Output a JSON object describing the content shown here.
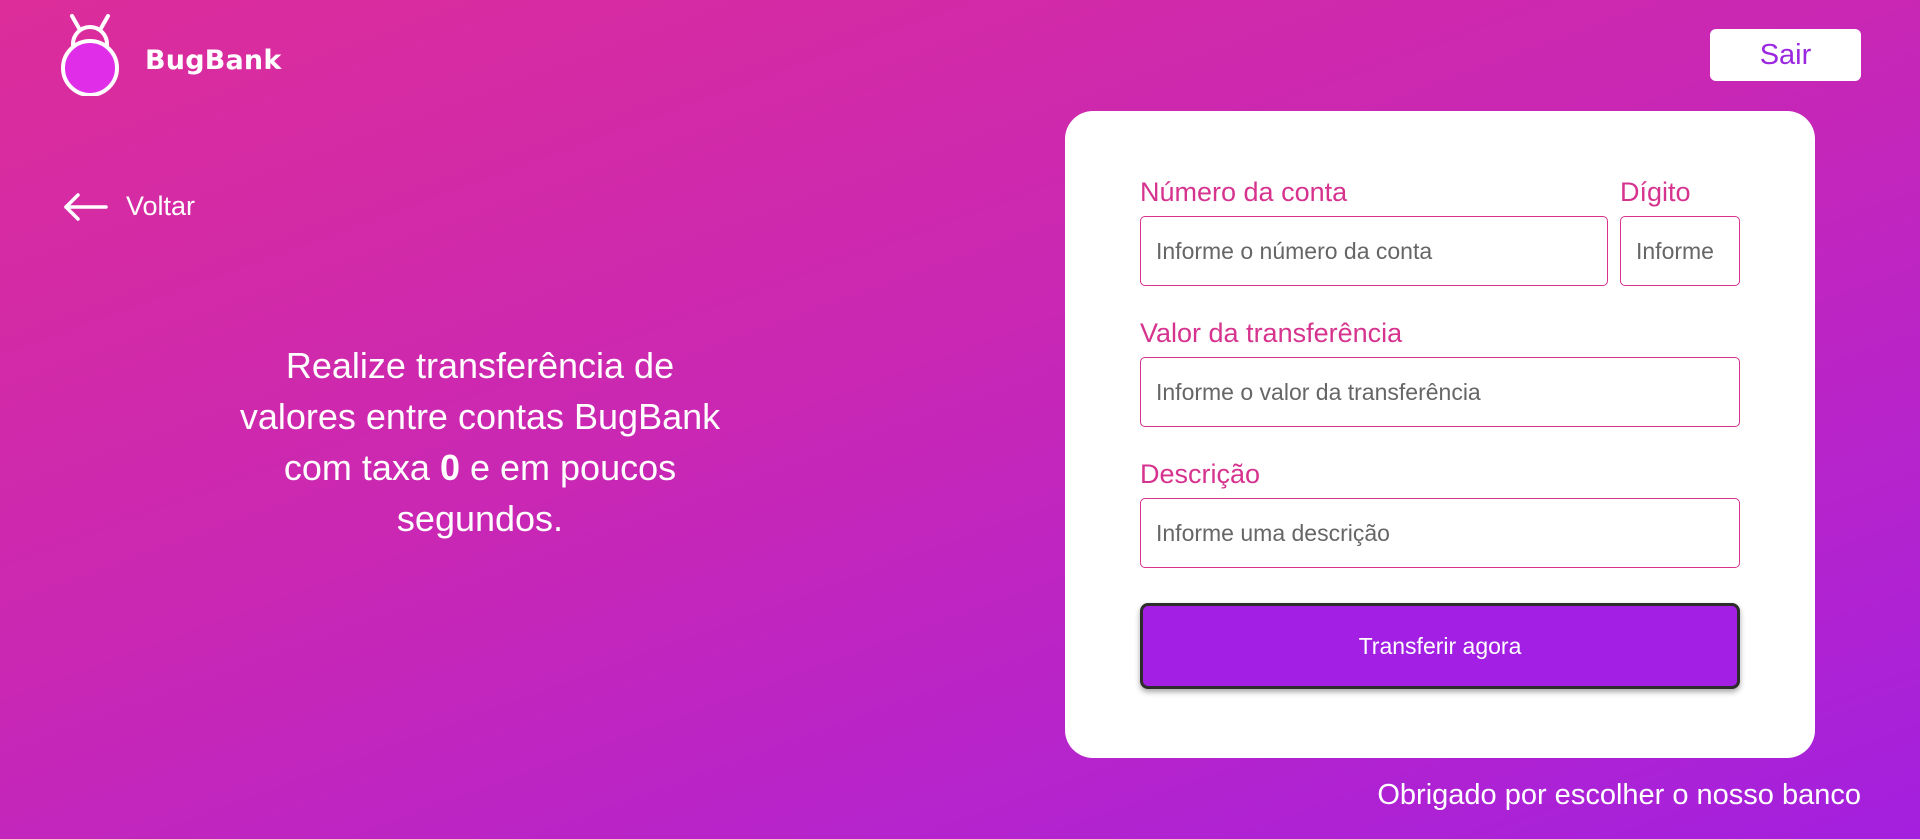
{
  "app": {
    "name": "BugBank",
    "logo_icon": "bug-icon"
  },
  "header": {
    "logout_label": "Sair"
  },
  "nav": {
    "back_label": "Voltar",
    "back_icon": "arrow-left-icon"
  },
  "hero": {
    "text_before": "Realize transferência de valores entre contas BugBank com taxa ",
    "text_bold": "0",
    "text_after": " e em poucos segundos."
  },
  "form": {
    "account_number": {
      "label": "Número da conta",
      "placeholder": "Informe o número da conta",
      "value": ""
    },
    "digit": {
      "label": "Dígito",
      "placeholder": "Informe",
      "value": ""
    },
    "amount": {
      "label": "Valor da transferência",
      "placeholder": "Informe o valor da transferência",
      "value": ""
    },
    "description": {
      "label": "Descrição",
      "placeholder": "Informe uma descrição",
      "value": ""
    },
    "submit_label": "Transferir agora"
  },
  "footer": {
    "text": "Obrigado por escolher o nosso banco"
  },
  "colors": {
    "accent": "#a21fe3",
    "label": "#d6338f",
    "logout_text": "#9b27e0",
    "background_start": "#dc2d9a",
    "background_end": "#a320de"
  }
}
